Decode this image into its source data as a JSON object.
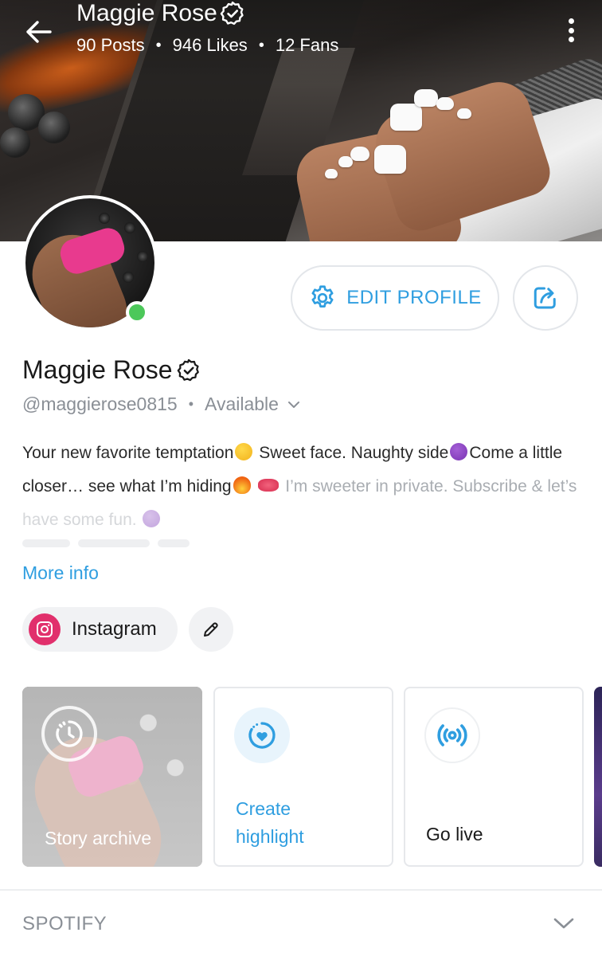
{
  "header": {
    "name": "Maggie Rose",
    "posts": "90 Posts",
    "likes": "946 Likes",
    "fans": "12 Fans",
    "separator": "•"
  },
  "profile": {
    "display_name": "Maggie Rose",
    "handle": "@maggierose0815",
    "separator": "•",
    "status": "Available",
    "online_color": "#4cc85a"
  },
  "buttons": {
    "edit_profile": "EDIT PROFILE"
  },
  "bio": {
    "part1": "Your new favorite temptation",
    "part2": " Sweet face. Naughty side",
    "part3": "Come a little closer… see what I’m hiding",
    "part4": " I’m sweeter in private. Subscribe & let’s",
    "part5": "have some fun. "
  },
  "more_info": "More info",
  "social": {
    "instagram_label": "Instagram"
  },
  "cards": {
    "story_archive": "Story archive",
    "create_highlight": "Create highlight",
    "go_live": "Go live"
  },
  "sections": {
    "spotify": "SPOTIFY"
  },
  "colors": {
    "accent": "#2f9ee0",
    "instagram": "#e1306c",
    "muted_text": "#8a8f96"
  },
  "icons": {
    "back": "arrow-left-icon",
    "verified": "verified-badge-icon",
    "menu": "more-vertical-icon",
    "settings": "gear-icon",
    "share": "share-icon",
    "dropdown": "chevron-down-icon",
    "instagram": "instagram-icon",
    "edit": "pencil-icon",
    "archive": "clock-history-icon",
    "highlight": "heart-circle-icon",
    "live": "broadcast-icon"
  }
}
